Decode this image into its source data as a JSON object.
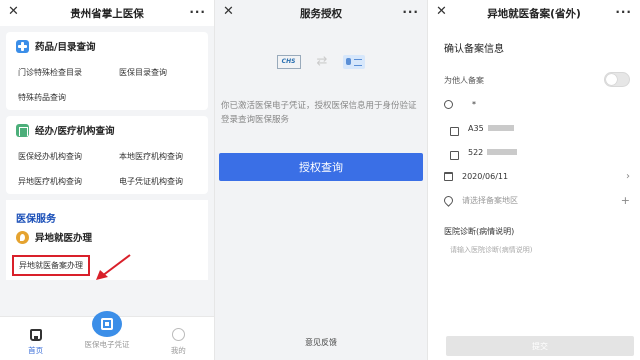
{
  "screen1": {
    "title": "贵州省掌上医保",
    "close": "✕",
    "more": "···",
    "card1": {
      "title": "药品/目录查询",
      "items": [
        "门诊特殊检查目录",
        "医保目录查询",
        "特殊药品查询"
      ]
    },
    "card2": {
      "title": "经办/医疗机构查询",
      "items": [
        "医保经办机构查询",
        "本地医疗机构查询",
        "异地医疗机构查询",
        "电子凭证机构查询"
      ]
    },
    "section": "医保服务",
    "remote_title": "异地就医办理",
    "remote_item": "异地就医备案办理",
    "nav": {
      "home": "首页",
      "qr": "医保电子凭证",
      "me": "我的"
    }
  },
  "screen2": {
    "title": "服务授权",
    "close": "✕",
    "more": "···",
    "logo_text": "CHS",
    "swap": "⇄",
    "desc": "你已激活医保电子凭证，授权医保信息用于身份验证登录查询医保服务",
    "button": "授权查询",
    "feedback": "意见反馈"
  },
  "screen3": {
    "title": "异地就医备案(省外)",
    "close": "✕",
    "more": "···",
    "section": "确认备案信息",
    "for_other": "为他人备案",
    "name": "*",
    "id_prefix": "A35",
    "phone_prefix": "522",
    "date": "2020/06/11",
    "area_placeholder": "请选择备案地区",
    "diag_label": "医院诊断(病情说明)",
    "diag_placeholder": "请输入医院诊断(病情说明)",
    "submit": "提交"
  }
}
